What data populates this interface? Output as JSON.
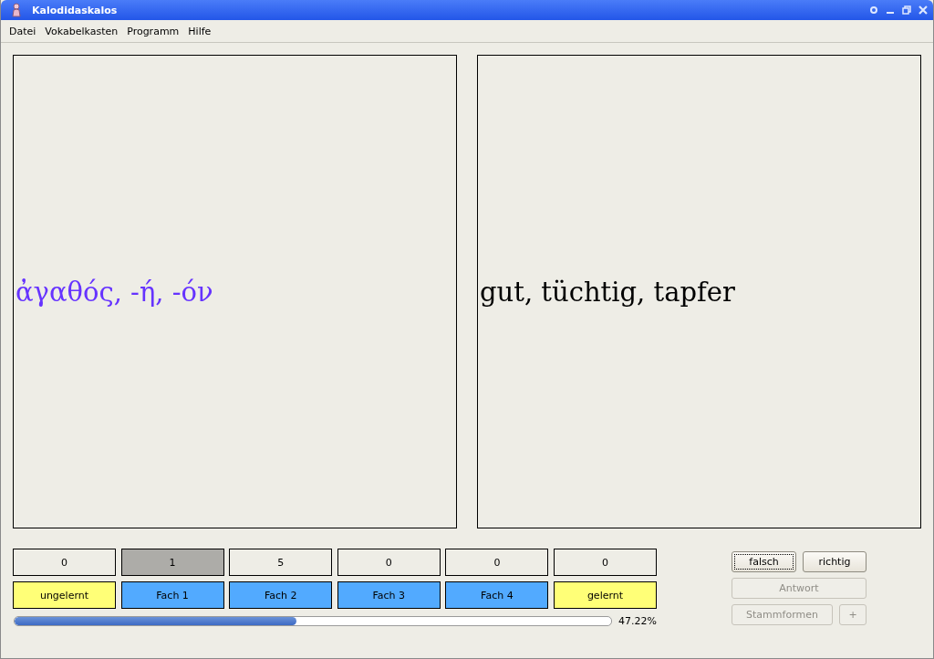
{
  "window": {
    "title": "Kalodidaskalos"
  },
  "menu": [
    "Datei",
    "Vokabelkasten",
    "Programm",
    "Hilfe"
  ],
  "cards": [
    {
      "text": "ἀγαθός, -ή, -όν",
      "color": "#6633ff"
    },
    {
      "text": "gut, tüchtig, tapfer",
      "color": "#000000"
    }
  ],
  "boxes": [
    {
      "count": "0",
      "selected": false,
      "label": "ungelernt",
      "color": "#ffff77"
    },
    {
      "count": "1",
      "selected": true,
      "label": "Fach 1",
      "color": "#52aaff"
    },
    {
      "count": "5",
      "selected": false,
      "label": "Fach 2",
      "color": "#52aaff"
    },
    {
      "count": "0",
      "selected": false,
      "label": "Fach 3",
      "color": "#52aaff"
    },
    {
      "count": "0",
      "selected": false,
      "label": "Fach 4",
      "color": "#52aaff"
    },
    {
      "count": "0",
      "selected": false,
      "label": "gelernt",
      "color": "#ffff77"
    }
  ],
  "progress": {
    "level": 0.4722,
    "reading": "47.22%"
  },
  "buttons": [
    {
      "label": "falsch",
      "disabled": false,
      "focused": true
    },
    {
      "label": "richtig",
      "disabled": false,
      "focused": false
    },
    {
      "label": "Antwort",
      "disabled": true,
      "focused": false
    },
    {
      "label": "Stammformen",
      "disabled": true,
      "focused": false
    },
    {
      "label": "+",
      "disabled": true,
      "focused": false
    }
  ]
}
